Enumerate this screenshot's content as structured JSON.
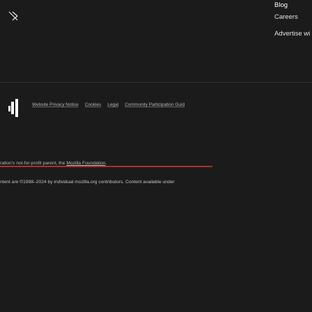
{
  "nav": {
    "blog": "Blog",
    "careers": "Careers",
    "advertise": "Advertise wi"
  },
  "legal": {
    "links": [
      "Website Privacy Notice",
      "Cookies",
      "Legal",
      "Community Participation Guid"
    ]
  },
  "foundation": {
    "prefix": "ration's not-for-profit parent, the ",
    "link": "Mozilla Foundation",
    "suffix": "."
  },
  "copyright": {
    "text": "ntent are ©1998–2024 by individual mozilla.org contributors. Content available under"
  },
  "icons": {
    "collapse": "chevron-right-icon",
    "logo": "mozilla-logo-icon"
  }
}
